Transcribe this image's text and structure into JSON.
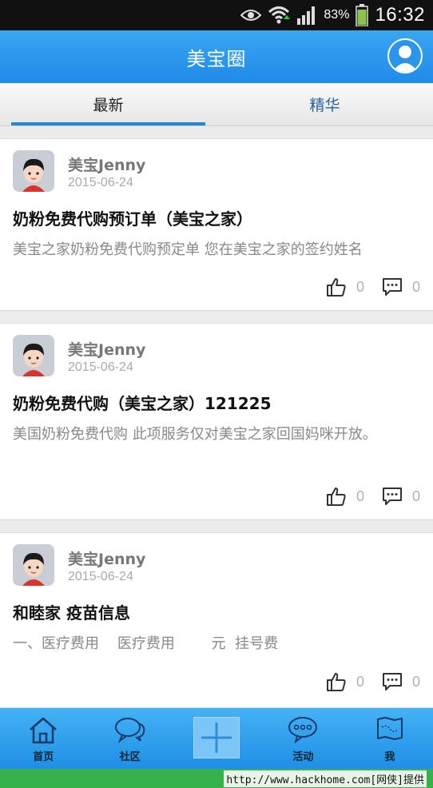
{
  "status_bar": {
    "battery": "83%",
    "time": "16:32"
  },
  "header": {
    "title": "美宝圈"
  },
  "tabs": [
    {
      "label": "最新",
      "active": true
    },
    {
      "label": "精华",
      "active": false
    }
  ],
  "posts": [
    {
      "author": "美宝Jenny",
      "date": "2015-06-24",
      "title": "奶粉免费代购预订单（美宝之家）",
      "excerpt": "美宝之家奶粉免费代购预定单  您在美宝之家的签约姓名",
      "likes": "0",
      "comments": "0"
    },
    {
      "author": "美宝Jenny",
      "date": "2015-06-24",
      "title": "奶粉免费代购（美宝之家）121225",
      "excerpt": "美国奶粉免费代购  此项服务仅对美宝之家回国妈咪开放。",
      "likes": "0",
      "comments": "0"
    },
    {
      "author": "美宝Jenny",
      "date": "2015-06-24",
      "title": "和睦家 疫苗信息",
      "excerpt": "一、医疗费用    医疗费用        元  挂号费",
      "likes": "0",
      "comments": "0"
    }
  ],
  "bottom_nav": [
    {
      "label": "首页",
      "icon": "home-icon"
    },
    {
      "label": "社区",
      "icon": "chat-bubbles-icon"
    },
    {
      "label": "",
      "icon": "plus-icon"
    },
    {
      "label": "活动",
      "icon": "speech-dots-icon"
    },
    {
      "label": "我",
      "icon": "map-icon"
    }
  ],
  "watermark": "http://www.hackhome.com[网侠]提供",
  "colors": {
    "header_blue": "#1f8be8",
    "tab_indicator": "#1a8ad8",
    "inactive_tab_text": "#2a60a8",
    "watermark_green": "#35b34a"
  }
}
